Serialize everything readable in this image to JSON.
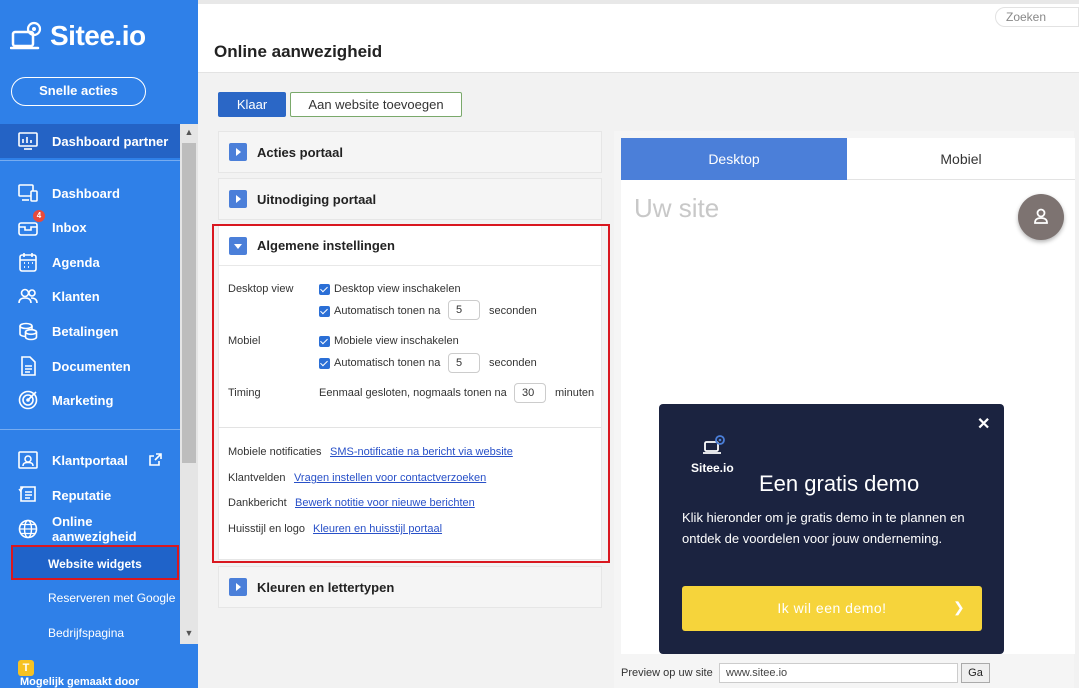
{
  "brand": {
    "name": "Sitee.io"
  },
  "sidebar": {
    "quick_actions": "Snelle acties",
    "partner": "Dashboard partner",
    "items": [
      {
        "label": "Dashboard",
        "icon": "monitor-icon"
      },
      {
        "label": "Inbox",
        "icon": "inbox-icon",
        "badge": "4"
      },
      {
        "label": "Agenda",
        "icon": "calendar-icon"
      },
      {
        "label": "Klanten",
        "icon": "users-icon"
      },
      {
        "label": "Betalingen",
        "icon": "coins-icon"
      },
      {
        "label": "Documenten",
        "icon": "document-icon"
      },
      {
        "label": "Marketing",
        "icon": "target-icon"
      }
    ],
    "items2": [
      {
        "label": "Klantportaal",
        "icon": "portal-icon"
      },
      {
        "label": "Reputatie",
        "icon": "reputation-icon"
      },
      {
        "label": "Online aanwezigheid",
        "icon": "globe-icon"
      }
    ],
    "subitems": [
      "Website widgets",
      "Reserveren met Google",
      "Bedrijfspagina"
    ],
    "footer": "Mogelijk gemaakt door"
  },
  "topbar": {
    "search_placeholder": "Zoeken"
  },
  "header": {
    "title": "Online aanwezigheid"
  },
  "actions": {
    "done": "Klaar",
    "add_to_website": "Aan website toevoegen"
  },
  "accordion": {
    "acties": "Acties portaal",
    "uitnodiging": "Uitnodiging portaal",
    "algemeen": "Algemene instellingen",
    "kleuren": "Kleuren en lettertypen"
  },
  "settings": {
    "desktop_view": "Desktop view",
    "desktop_enable": "Desktop view inschakelen",
    "auto_show": "Automatisch tonen na",
    "desktop_seconds": "5",
    "seconds": "seconden",
    "mobiel": "Mobiel",
    "mobile_enable": "Mobiele view inschakelen",
    "mobile_seconds": "5",
    "timing": "Timing",
    "timing_text": "Eenmaal gesloten, nogmaals tonen na",
    "timing_value": "30",
    "minutes": "minuten",
    "notif_label": "Mobiele notificaties",
    "notif_link": "SMS-notificatie na bericht via website",
    "fields_label": "Klantvelden",
    "fields_link": "Vragen instellen voor contactverzoeken",
    "thanks_label": "Dankbericht",
    "thanks_link": "Bewerk notitie voor nieuwe berichten",
    "style_label": "Huisstijl en logo",
    "style_link": "Kleuren en huisstijl portaal"
  },
  "preview": {
    "tab_desktop": "Desktop",
    "tab_mobile": "Mobiel",
    "placeholder": "Uw site",
    "demo_logo": "Sitee.io",
    "demo_title": "Een gratis demo",
    "demo_text": "Klik hieronder om je gratis demo in te plannen en ontdek de voordelen voor jouw onderneming.",
    "demo_button": "Ik wil een demo!",
    "bar_label": "Preview op uw site",
    "url": "www.sitee.io",
    "go": "Ga"
  },
  "colors": {
    "brand_blue": "#2f80e8",
    "accent_yellow": "#f6d43b",
    "highlight_red": "#d9171f",
    "tab_blue": "#4b7fd9"
  }
}
